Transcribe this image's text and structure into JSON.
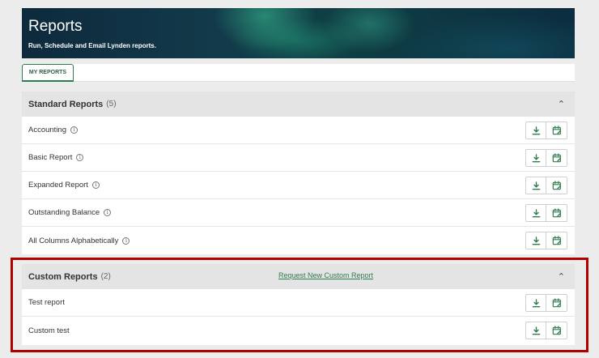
{
  "header": {
    "title": "Reports",
    "subtitle": "Run, Schedule and Email Lynden reports."
  },
  "tabs": [
    {
      "label": "MY REPORTS",
      "active": true
    }
  ],
  "standard": {
    "title": "Standard Reports",
    "count": "(5)",
    "items": [
      {
        "label": "Accounting",
        "info": true
      },
      {
        "label": "Basic Report",
        "info": true
      },
      {
        "label": "Expanded Report",
        "info": true
      },
      {
        "label": "Outstanding Balance",
        "info": true
      },
      {
        "label": "All Columns Alphabetically",
        "info": true
      }
    ]
  },
  "custom": {
    "title": "Custom Reports",
    "count": "(2)",
    "request_link": "Request New Custom Report",
    "items": [
      {
        "label": "Test report"
      },
      {
        "label": "Custom test"
      }
    ]
  },
  "icons": {
    "download": "download-icon",
    "schedule": "calendar-edit-icon",
    "collapse": "chevron-up-icon",
    "info": "info-icon"
  },
  "colors": {
    "accent": "#2e7d4f",
    "highlight": "#b00000"
  }
}
